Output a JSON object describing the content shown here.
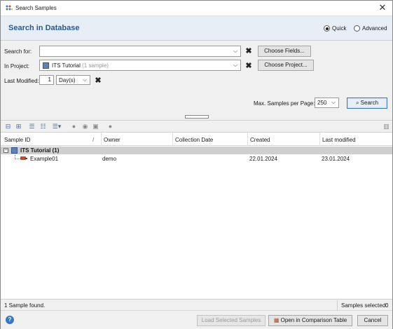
{
  "window": {
    "title": "Search Samples",
    "close_glyph": "✕"
  },
  "header": {
    "title": "Search in Database",
    "mode_quick": "Quick",
    "mode_advanced": "Advanced",
    "selected_mode": "Quick"
  },
  "form": {
    "search_for_label": "Search for:",
    "search_for_value": "",
    "choose_fields_label": "Choose Fields...",
    "in_project_label": "In Project:",
    "project_name": "ITS Tutorial",
    "project_count": "(1 sample)",
    "choose_project_label": "Choose Project...",
    "last_modified_label": "Last Modified:",
    "last_modified_value": "1",
    "last_modified_unit": "Day(s)",
    "max_samples_label": "Max. Samples per Page:",
    "max_samples_value": "250",
    "search_button_label": "Search",
    "clear_glyph": "✖"
  },
  "toolbar": {
    "icons": [
      "collapse-all-icon",
      "expand-all-icon",
      "select-all-icon",
      "deselect-icon",
      "list-options-icon",
      "sample-action-icon",
      "inspect-icon",
      "export-icon",
      "globe-icon",
      "column-chooser-icon"
    ]
  },
  "table": {
    "columns": [
      "Sample ID",
      "Owner",
      "Collection Date",
      "Created",
      "Last modified"
    ],
    "sort_indicator": "/",
    "group": {
      "label": "ITS Tutorial (1)",
      "toggle": "−"
    },
    "rows": [
      {
        "sample_id": "Example01",
        "owner": "demo",
        "collection_date": "",
        "created": "22.01.2024",
        "last_modified": "23.01.2024"
      }
    ]
  },
  "status": {
    "found_text": "1 Sample found.",
    "selected_text": "Samples selected:",
    "selected_count": "0"
  },
  "footer": {
    "load_label": "Load Selected Samples",
    "open_comparison_label": "Open in Comparison Table",
    "cancel_label": "Cancel",
    "help_glyph": "?"
  },
  "colors": {
    "accent": "#2a5a94",
    "header_bg": "#e8eef6",
    "group_row_bg": "#cfcfcf",
    "primary_border": "#3b78c4"
  }
}
